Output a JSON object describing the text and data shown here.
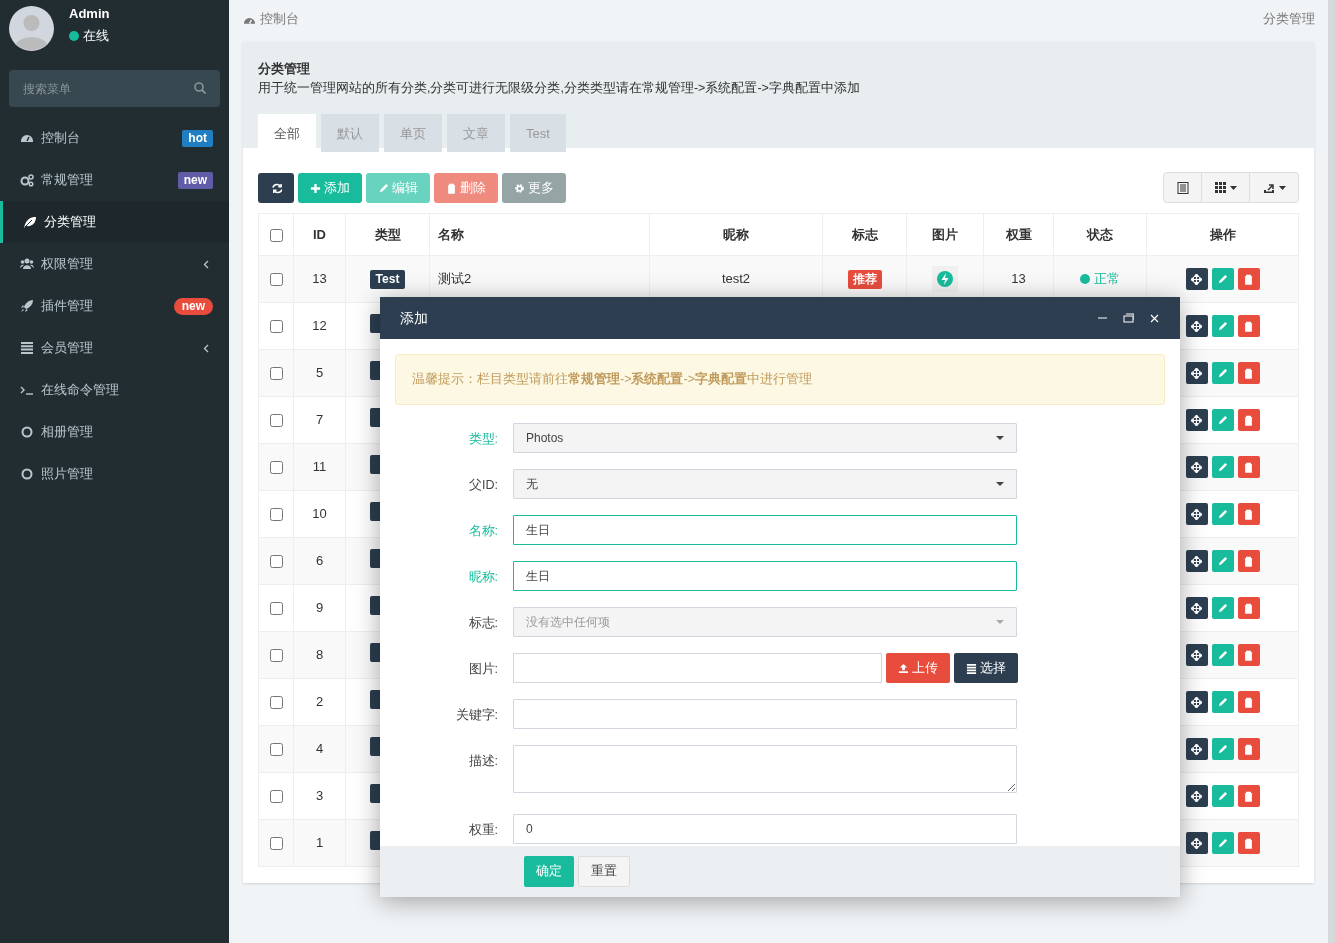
{
  "sidebar": {
    "user": {
      "name": "Admin",
      "status": "在线"
    },
    "search": {
      "placeholder": "搜索菜单"
    },
    "items": [
      {
        "label": "控制台",
        "selected": false,
        "badge": {
          "text": "hot",
          "color": "#1f7fc1",
          "kind": "label"
        }
      },
      {
        "label": "常规管理",
        "selected": false,
        "badge": {
          "text": "new",
          "color": "#605ca8",
          "kind": "label"
        }
      },
      {
        "label": "分类管理",
        "selected": true
      },
      {
        "label": "权限管理",
        "selected": false,
        "has_children": true
      },
      {
        "label": "插件管理",
        "selected": false,
        "badge": {
          "text": "new",
          "color": "#e74c3c",
          "kind": "pill"
        }
      },
      {
        "label": "会员管理",
        "selected": false,
        "has_children": true
      },
      {
        "label": "在线命令管理",
        "selected": false
      },
      {
        "label": "相册管理",
        "selected": false
      },
      {
        "label": "照片管理",
        "selected": false
      }
    ]
  },
  "header": {
    "breadcrumb": "控制台",
    "page_title": "分类管理"
  },
  "panel": {
    "title": "分类管理",
    "description": "用于统一管理网站的所有分类,分类可进行无限级分类,分类类型请在常规管理->系统配置->字典配置中添加",
    "tabs": [
      {
        "label": "全部",
        "selected": true
      },
      {
        "label": "默认",
        "selected": false
      },
      {
        "label": "单页",
        "selected": false
      },
      {
        "label": "文章",
        "selected": false
      },
      {
        "label": "Test",
        "selected": false
      }
    ],
    "toolbar": [
      {
        "kind": "refresh",
        "disabled": false
      },
      {
        "kind": "add",
        "label": "添加",
        "disabled": false
      },
      {
        "kind": "edit",
        "label": "编辑",
        "disabled": true
      },
      {
        "kind": "delete",
        "label": "删除",
        "disabled": true
      },
      {
        "kind": "more",
        "label": "更多",
        "disabled": false
      }
    ]
  },
  "table": {
    "select_all_checked": false,
    "columns": [
      "ID",
      "类型",
      "名称",
      "昵称",
      "标志",
      "图片",
      "权重",
      "状态",
      "操作"
    ],
    "rows": [
      {
        "checked": false,
        "id": "13",
        "type": "Test",
        "name": "测试2",
        "nickname": "test2",
        "flag": "推荐",
        "has_image": true,
        "weight": "13",
        "status": "正常"
      },
      {
        "checked": false,
        "id": "12"
      },
      {
        "checked": false,
        "id": "5"
      },
      {
        "checked": false,
        "id": "7"
      },
      {
        "checked": false,
        "id": "11"
      },
      {
        "checked": false,
        "id": "10"
      },
      {
        "checked": false,
        "id": "6"
      },
      {
        "checked": false,
        "id": "9"
      },
      {
        "checked": false,
        "id": "8"
      },
      {
        "checked": false,
        "id": "2"
      },
      {
        "checked": false,
        "id": "4"
      },
      {
        "checked": false,
        "id": "3"
      },
      {
        "checked": false,
        "id": "1"
      }
    ]
  },
  "modal": {
    "title": "添加",
    "notice": "温馨提示：栏目类型请前往**常规管理**->**系统配置**->**字典配置**中进行管理",
    "fields": [
      {
        "kind": "select",
        "label": "类型:",
        "value": "Photos",
        "valid": true
      },
      {
        "kind": "select",
        "label": "父ID:",
        "value": "无",
        "valid": false
      },
      {
        "kind": "text",
        "label": "名称:",
        "value": "生日",
        "valid": true
      },
      {
        "kind": "text",
        "label": "昵称:",
        "value": "生日",
        "valid": true
      },
      {
        "kind": "multiselect",
        "label": "标志:",
        "placeholder": "没有选中任何项",
        "valid": false
      },
      {
        "kind": "upload",
        "label": "图片:",
        "upload_label": "上传",
        "choose_label": "选择",
        "valid": false
      },
      {
        "kind": "text",
        "label": "关键字:",
        "valid": false
      },
      {
        "kind": "textarea",
        "label": "描述:",
        "valid": false
      },
      {
        "kind": "text",
        "label": "权重:",
        "value": "0",
        "valid": false
      }
    ],
    "buttons": [
      {
        "kind": "primary",
        "label": "确定"
      },
      {
        "kind": "default",
        "label": "重置"
      }
    ]
  }
}
